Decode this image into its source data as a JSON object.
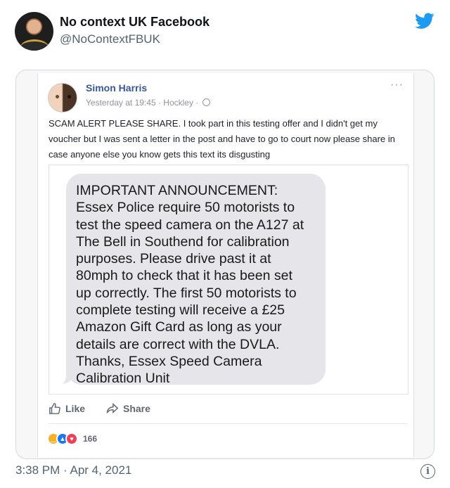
{
  "tweet": {
    "display_name": "No context UK Facebook",
    "handle": "@NoContextFBUK",
    "timestamp": "3:38 PM · Apr 4, 2021",
    "brand_color": "#1d9bf0"
  },
  "fb_post": {
    "author": "Simon Harris",
    "meta": "Yesterday at 19:45 · Hockley ·",
    "more": "···",
    "text": "SCAM ALERT PLEASE SHARE. I took part in this testing offer and I didn't get my voucher but I was sent a letter in the post and have to go to court now please share in case anyone else you know gets this text its disgusting",
    "actions": {
      "like": "Like",
      "share": "Share"
    },
    "reaction_count": "166"
  },
  "sms": {
    "lines": [
      "IMPORTANT ANNOUNCEMENT:",
      "Essex Police require 50 motorists to",
      "test the speed camera on the A127 at",
      "The Bell in Southend for calibration",
      "purposes. Please drive past it at",
      "80mph to check that it has been set",
      "up correctly. The first 50 motorists to",
      "complete testing will receive a £25",
      "Amazon Gift Card as long as your",
      "details are correct with the DVLA.",
      "Thanks, Essex Speed Camera",
      "Calibration Unit"
    ]
  }
}
